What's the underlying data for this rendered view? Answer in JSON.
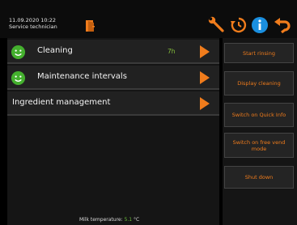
{
  "header": {
    "datetime": "11.09.2020 10:22",
    "user": "Service technician"
  },
  "icons": {
    "door": "door-icon",
    "wrench": "wrench-icon",
    "history": "history-icon",
    "info": "info-icon",
    "back": "back-icon"
  },
  "menu": {
    "items": [
      {
        "label": "Cleaning",
        "value": "7h",
        "status_icon": "green-smiley-icon"
      },
      {
        "label": "Maintenance intervals",
        "status_icon": "green-smiley-icon"
      },
      {
        "label": "Ingredient management"
      }
    ]
  },
  "footer": {
    "milk_label": "Milk temperature:",
    "milk_value": "5.1",
    "milk_unit": "°C"
  },
  "actions": {
    "start_rinsing": "Start rinsing",
    "display_cleaning": "Display cleaning",
    "quick_info": "Switch on Quick Info",
    "free_vend": "Switch on free vend mode",
    "shut_down": "Shut down"
  },
  "colors": {
    "accent": "#f07c1c",
    "status_green": "#86c13c",
    "info_blue": "#1a8fe0"
  }
}
